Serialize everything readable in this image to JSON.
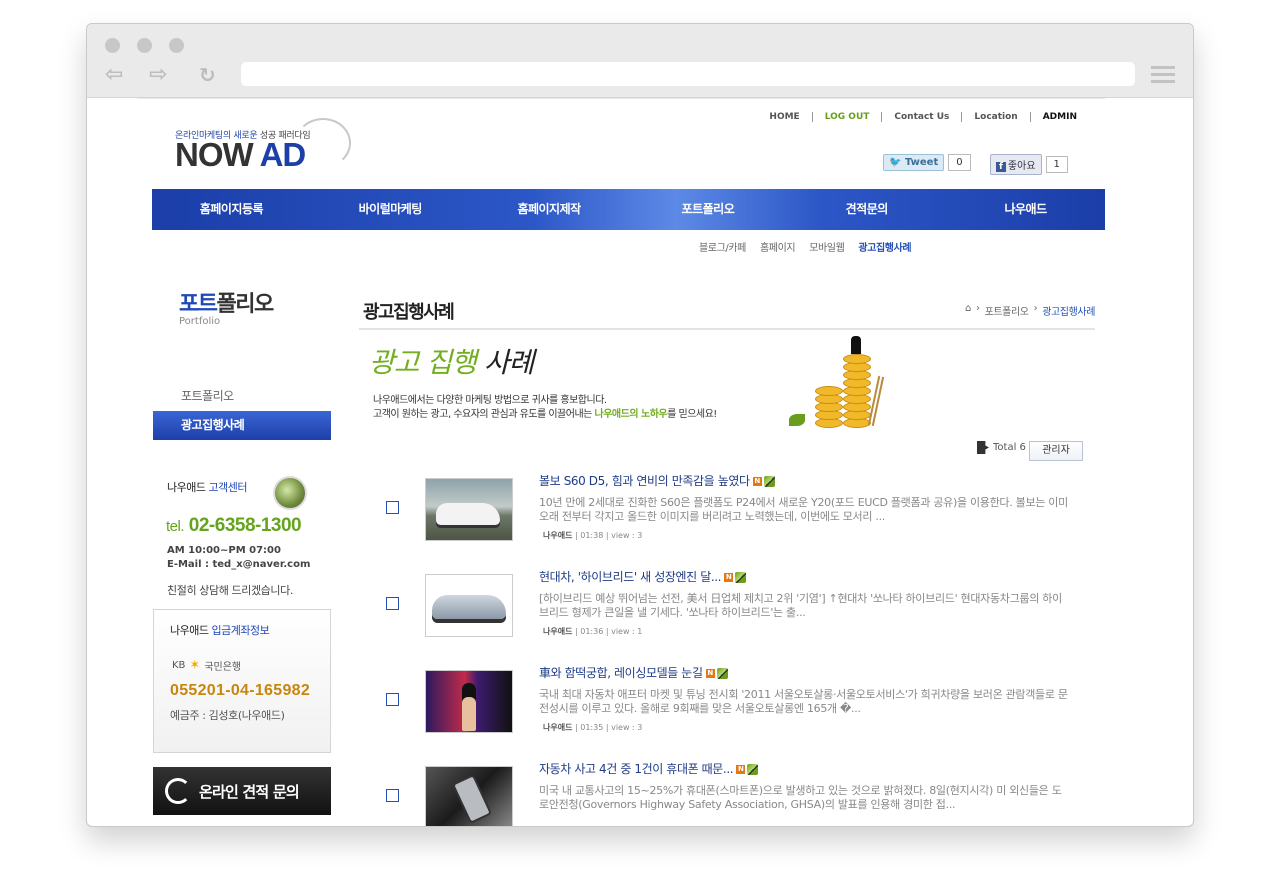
{
  "site": {
    "logo_tagline_a": "온라인마케팅의 새로운",
    "logo_tagline_b": " 성공 패러다임",
    "logo_now": "NOW",
    "logo_ad": " AD"
  },
  "topmenu": {
    "home": "HOME",
    "logout": "LOG OUT",
    "contact": "Contact Us",
    "location": "Location",
    "admin": "ADMIN"
  },
  "social": {
    "tweet_label": "Tweet",
    "tweet_count": "0",
    "like_label": "좋아요",
    "like_count": "1"
  },
  "gnb": [
    "홈페이지등록",
    "바이럴마케팅",
    "홈페이지제작",
    "포트폴리오",
    "견적문의",
    "나우애드"
  ],
  "submenu": [
    "블로그/카페",
    "홈페이지",
    "모바일웹",
    "광고집행사례"
  ],
  "lnb": {
    "title_a": "포트",
    "title_b": "폴리오",
    "subtitle": "Portfolio",
    "items": [
      "포트폴리오",
      "광고집행사례"
    ]
  },
  "customer_center": {
    "title_a": "나우애드",
    "title_b": " 고객센터",
    "tel_prefix": "tel.",
    "tel": " 02-6358-1300",
    "hours": "AM 10:00~PM 07:00",
    "email": "E-Mail : ted_x@naver.com",
    "kind": "친절히 상담해 드리겠습니다."
  },
  "bank": {
    "title_a": "나우애드",
    "title_b": " 입금계좌정보",
    "bank_kb": "KB",
    "bank_name": "국민은행",
    "account": "055201-04-165982",
    "holder": "예금주 : 김성호(나우애드)"
  },
  "quote_button": "온라인 견적 문의",
  "content": {
    "title": "광고집행사례",
    "breadcrumb": [
      "포트폴리오",
      "광고집행사례"
    ],
    "banner_g": "광고 집행",
    "banner_k": " 사례",
    "banner_line1": "나우애드에서는 다양한 마케팅 방법으로 귀사를 홍보합니다.",
    "banner_line2_a": "고객이 원하는 광고, 수요자의 관심과 유도를 이끌어내는 ",
    "banner_line2_b": "나우애드의 노하우",
    "banner_line2_c": "를 믿으세요!",
    "total": "Total 6",
    "admin_button": "관리자"
  },
  "posts": [
    {
      "title": "볼보 S60 D5, 힘과 연비의 만족감을 높였다",
      "body": "10년 만에 2세대로 진화한 S60은 플랫폼도 P24에서 새로운 Y20(포드 EUCD 플랫폼과 공유)을 이용한다. 볼보는 이미 오래 전부터 각지고 올드한 이미지를 버리려고 노력했는데, 이번에도 모서리 ...",
      "author": "나우애드",
      "time": "01:38",
      "views": "view : 3"
    },
    {
      "title": "현대차, '하이브리드' 새 성장엔진 달...",
      "body": "[하이브리드 예상 뛰어넘는 선전, 美서 日업체 제치고 2위 '기염'] ↑현대차 '쏘나타 하이브리드' 현대자동차그룹의 하이브리드 형제가 큰일을 낼 기세다. '쏘나타 하이브리드'는 출...",
      "author": "나우애드",
      "time": "01:36",
      "views": "view : 1"
    },
    {
      "title": "車와 함떡궁합, 레이싱모델들 눈길",
      "body": "국내 최대 자동차 애프터 마켓 및 튜닝 전시회 '2011 서울오토살롱·서울오토서비스'가 희귀차량을 보러온 관람객들로 문전성시를 이루고 있다. 올해로 9회째를 맞은 서울오토살롱엔 165개 �...",
      "author": "나우애드",
      "time": "01:35",
      "views": "view : 3"
    },
    {
      "title": "자동차 사고 4건 중 1건이 휴대폰 때문...",
      "body": "미국 내 교통사고의 15~25%가 휴대폰(스마트폰)으로 발생하고 있는 것으로 밝혀졌다. 8일(현지시각) 미 외신들은 도로안전청(Governors Highway Safety Association, GHSA)의 발표를 인용해 경미한 접...",
      "author": "",
      "time": "",
      "views": ""
    }
  ]
}
